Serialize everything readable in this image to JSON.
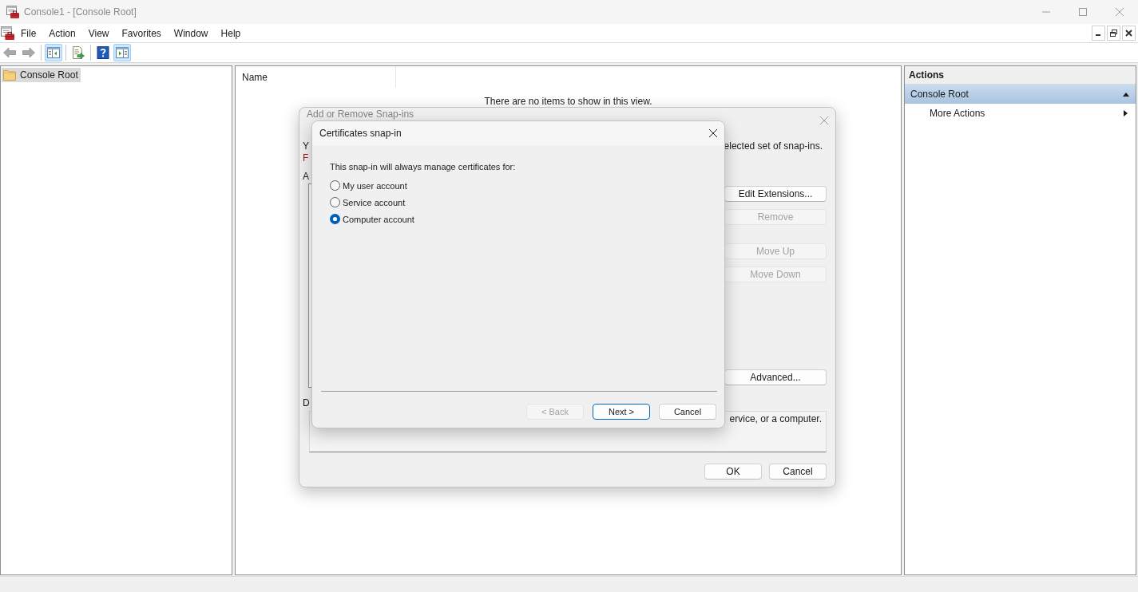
{
  "window": {
    "title": "Console1 - [Console Root]"
  },
  "menu": [
    "File",
    "Action",
    "View",
    "Favorites",
    "Window",
    "Help"
  ],
  "toolbar": {
    "groups": [
      [
        {
          "kind": "back",
          "disabled": true,
          "pressed": false
        },
        {
          "kind": "forward",
          "disabled": true,
          "pressed": false
        }
      ],
      [
        {
          "kind": "tree",
          "disabled": false,
          "pressed": true
        }
      ],
      [
        {
          "kind": "export",
          "disabled": false,
          "pressed": false
        }
      ],
      [
        {
          "kind": "help",
          "disabled": false,
          "pressed": false
        },
        {
          "kind": "pane",
          "disabled": false,
          "pressed": true
        }
      ]
    ]
  },
  "tree": {
    "items": [
      {
        "label": "Console Root",
        "selected": true
      }
    ]
  },
  "list_view": {
    "columns": [
      "Name"
    ],
    "empty_message": "There are no items to show in this view."
  },
  "actions_pane": {
    "title": "Actions",
    "sections": [
      {
        "label": "Console Root",
        "expanded": true,
        "items": [
          {
            "label": "More Actions",
            "submenu": true
          }
        ]
      }
    ]
  },
  "add_remove_dialog": {
    "title": "Add or Remove Snap-ins",
    "intro": [
      {
        "kind": "normal",
        "start": "Y",
        "end": "elected set of snap-ins."
      },
      {
        "kind": "alert",
        "start": "F"
      }
    ],
    "list_label": "A",
    "side_buttons": [
      [
        {
          "label": "Edit Extensions...",
          "disabled": false
        },
        {
          "label": "Remove",
          "disabled": true
        }
      ],
      [
        {
          "label": "Move Up",
          "disabled": true
        },
        {
          "label": "Move Down",
          "disabled": true
        }
      ],
      [
        {
          "label": "Advanced...",
          "disabled": false
        }
      ]
    ],
    "info_box": {
      "label": "D",
      "text": "ervice, or a computer."
    },
    "buttons": [
      {
        "label": "OK",
        "disabled": false
      },
      {
        "label": "Cancel",
        "disabled": false
      }
    ]
  },
  "certificates_dialog": {
    "title": "Certificates snap-in",
    "prompt": "This snap-in will always manage certificates for:",
    "options": [
      {
        "label": "My user account",
        "selected": false
      },
      {
        "label": "Service account",
        "selected": false
      },
      {
        "label": "Computer account",
        "selected": true
      }
    ],
    "buttons": [
      {
        "label": "< Back",
        "disabled": true,
        "default": false
      },
      {
        "label": "Next >",
        "disabled": false,
        "default": true
      },
      {
        "label": "Cancel",
        "disabled": false,
        "default": false
      }
    ]
  }
}
